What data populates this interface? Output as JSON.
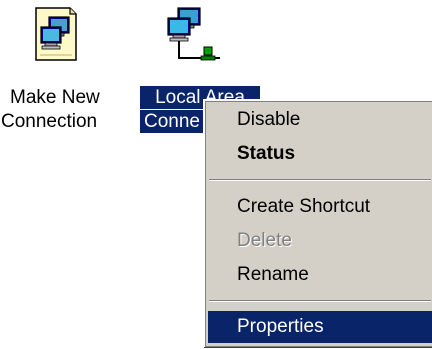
{
  "desktop": {
    "icons": [
      {
        "name": "make-new-connection",
        "label_line1": "Make New",
        "label_line2": "Connection",
        "icon": "new-connection-wizard-icon",
        "selected": false
      },
      {
        "name": "local-area-connection",
        "label_line1": "Local Area",
        "label_line2": "Conne",
        "icon": "network-connection-icon",
        "selected": true
      }
    ]
  },
  "context_menu": {
    "items": [
      {
        "label": "Disable",
        "style": "normal",
        "enabled": true
      },
      {
        "label": "Status",
        "style": "bold",
        "enabled": true
      },
      {
        "separator": true
      },
      {
        "label": "Create Shortcut",
        "style": "normal",
        "enabled": true
      },
      {
        "label": "Delete",
        "style": "normal",
        "enabled": false
      },
      {
        "label": "Rename",
        "style": "normal",
        "enabled": true
      },
      {
        "separator": true
      },
      {
        "label": "Properties",
        "style": "normal",
        "enabled": true,
        "highlighted": true
      }
    ]
  },
  "colors": {
    "selection": "#0a246a",
    "menu_background": "#d4d0c8",
    "disabled_text": "#808080"
  }
}
